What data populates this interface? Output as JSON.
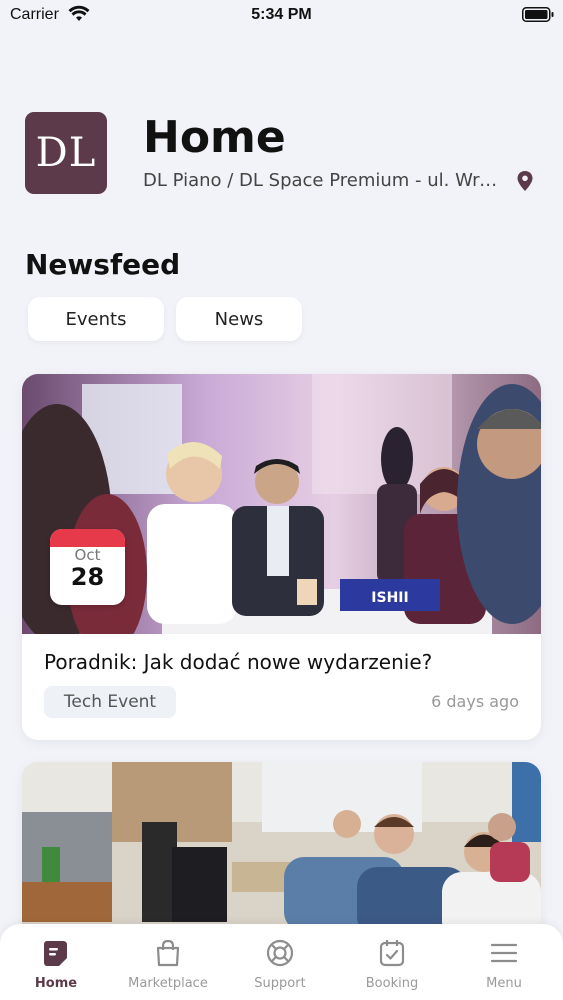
{
  "status_bar": {
    "carrier": "Carrier",
    "time": "5:34 PM"
  },
  "header": {
    "logo_text": "DL",
    "title": "Home",
    "location": "DL Piano / DL Space Premium - ul. Wro..."
  },
  "newsfeed": {
    "title": "Newsfeed",
    "filters": [
      "Events",
      "News"
    ]
  },
  "cards": [
    {
      "date_month": "Oct",
      "date_day": "28",
      "image_label": "ISHII",
      "title": "Poradnik: Jak dodać nowe wydarzenie?",
      "tag": "Tech Event",
      "time_ago": "6 days ago"
    }
  ],
  "tabbar": {
    "items": [
      {
        "label": "Home",
        "icon": "home-icon"
      },
      {
        "label": "Marketplace",
        "icon": "shopping-bag-icon"
      },
      {
        "label": "Support",
        "icon": "lifebuoy-icon"
      },
      {
        "label": "Booking",
        "icon": "calendar-check-icon"
      },
      {
        "label": "Menu",
        "icon": "hamburger-menu-icon"
      }
    ],
    "active_index": 0
  },
  "colors": {
    "brand": "#5d3a49",
    "background": "#f1f3f9",
    "date_accent": "#e63a4b"
  }
}
